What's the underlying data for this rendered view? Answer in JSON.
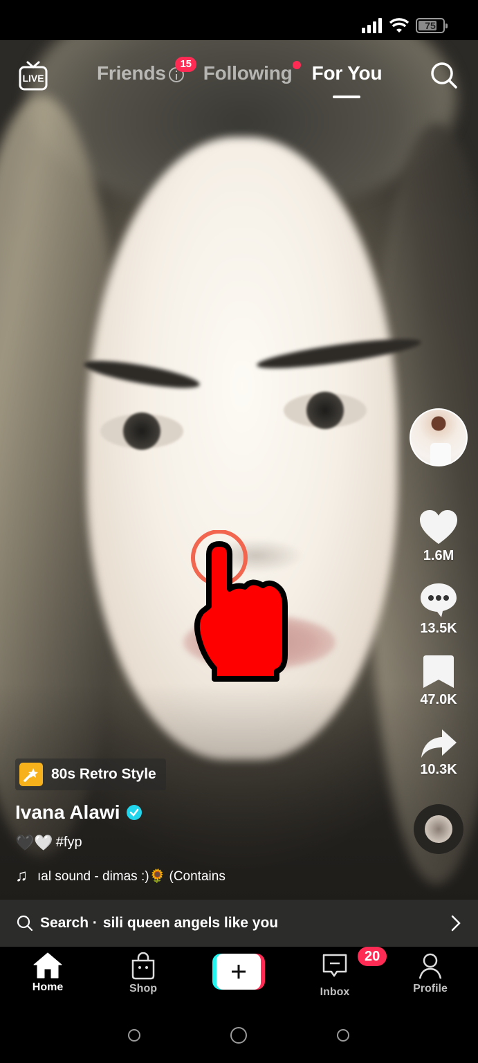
{
  "status_bar": {
    "battery_level": "75",
    "signal_icon": "signal-icon",
    "wifi_icon": "wifi-icon"
  },
  "top_nav": {
    "live_label": "LIVE",
    "tabs": [
      {
        "label": "Friends",
        "badge": "15",
        "active": false
      },
      {
        "label": "Following",
        "has_dot": true,
        "active": false
      },
      {
        "label": "For You",
        "active": true
      }
    ],
    "search_icon": "search-icon"
  },
  "video": {
    "effect": {
      "label": "80s Retro Style",
      "icon": "magic-wand-icon",
      "color": "#f7b21b"
    },
    "author": {
      "name": "Ivana Alawi",
      "verified": true
    },
    "caption": {
      "emojis": "🖤🤍",
      "hashtag": "#fyp"
    },
    "music": {
      "text": "ıal sound - dimas :)🌻 (Contains"
    }
  },
  "right_rail": {
    "likes": "1.6M",
    "comments": "13.5K",
    "bookmarks": "47.0K",
    "shares": "10.3K"
  },
  "search_suggestion": {
    "prefix": "Search ·",
    "query": "sili queen angels like you"
  },
  "bottom_nav": {
    "items": [
      {
        "label": "Home",
        "icon": "home-icon",
        "active": true
      },
      {
        "label": "Shop",
        "icon": "shop-bag-icon",
        "active": false
      },
      {
        "label": "",
        "icon": "plus-icon",
        "active": false
      },
      {
        "label": "Inbox",
        "icon": "inbox-icon",
        "badge": "20",
        "active": false
      },
      {
        "label": "Profile",
        "icon": "profile-icon",
        "active": false
      }
    ]
  },
  "colors": {
    "accent_red": "#fe2c55",
    "accent_cyan": "#25f4ee",
    "verified_blue": "#20d5ec",
    "tap_indicator": "#ff0000"
  }
}
